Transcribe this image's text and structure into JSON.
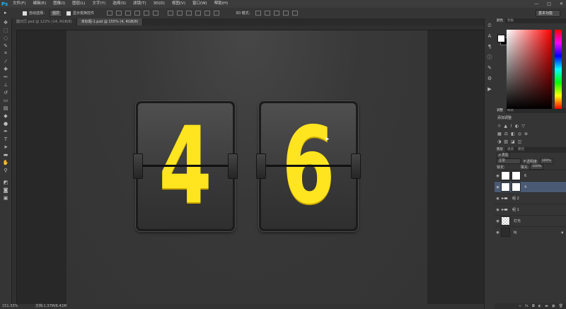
{
  "app": {
    "logo": "Ps"
  },
  "menu": [
    "文件(F)",
    "编辑(E)",
    "图像(I)",
    "图层(L)",
    "文字(Y)",
    "选择(S)",
    "滤镜(T)",
    "3D(D)",
    "视图(V)",
    "窗口(W)",
    "帮助(H)"
  ],
  "window_controls": [
    "—",
    "□",
    "✕"
  ],
  "options_bar": {
    "auto_select_label": "自动选择：",
    "auto_select_value": "图层",
    "show_transform_label": "显示变换控件",
    "mode_3d_label": "3D 模式：",
    "workspace": "基本功能"
  },
  "tabs": [
    {
      "label": "翻日历.psd @ 122% (14, RGB/8)",
      "active": false
    },
    {
      "label": "未标题-1.psd @ 155% (4, RGB/8)",
      "active": true
    }
  ],
  "flip_digits": [
    "4",
    "6"
  ],
  "status": {
    "zoom": "151.33%",
    "doc": "文档:1.37M/6.41M"
  },
  "panels": {
    "color_tabs": [
      "颜色",
      "色板"
    ],
    "adjust_tabs": [
      "调整",
      "样式"
    ],
    "adjust_title": "添加调整",
    "layers_tabs": [
      "图层",
      "通道",
      "路径"
    ],
    "kind_label": "ρ 类型",
    "blend_mode": "正常",
    "opacity_label": "不透明度:",
    "opacity_value": "100%",
    "lock_label": "锁定:",
    "fill_label": "填充:",
    "fill_value": "100%",
    "layers": [
      {
        "name": "6",
        "thumb": "white",
        "selected": false
      },
      {
        "name": "4",
        "thumb": "white",
        "selected": true
      },
      {
        "name": "组 2",
        "thumb": "folder",
        "selected": false
      },
      {
        "name": "组 1",
        "thumb": "folder",
        "selected": false
      },
      {
        "name": "灯光",
        "thumb": "check",
        "selected": false
      },
      {
        "name": "bj",
        "thumb": "dark",
        "selected": false
      }
    ]
  },
  "colors": {
    "digit": "#ffe51f",
    "accent": "#2ea8ff",
    "selected_layer": "#4a5a74"
  }
}
